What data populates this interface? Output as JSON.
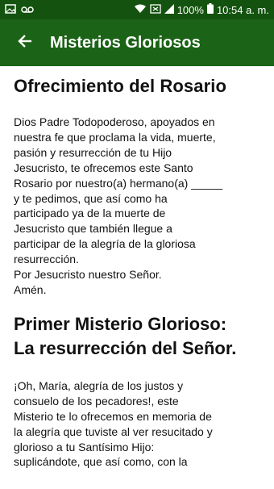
{
  "status_bar": {
    "battery_percent": "100%",
    "time": "10:54 a. m.",
    "icons": [
      "image-icon",
      "voicemail-icon",
      "wifi-icon",
      "cast-icon",
      "signal-icon",
      "battery-icon"
    ]
  },
  "app_bar": {
    "title": "Misterios Gloriosos",
    "back_icon": "arrow-back-icon"
  },
  "colors": {
    "status_bar": "#14530f",
    "app_bar": "#1b6316",
    "text": "#111111"
  },
  "sections": [
    {
      "heading": "Ofrecimiento del Rosario",
      "body": "Dios Padre Todopoderoso, apoyados en\nnuestra fe que proclama la vida, muerte,\npasión y resurrección de tu Hijo\nJesucristo, te ofrecemos este Santo\nRosario por nuestro(a) hermano(a) _____\ny te pedimos, que así como ha\nparticipado ya de la muerte de\nJesucristo que también llegue a\nparticipar de la alegría de la gloriosa\nresurrección.\nPor Jesucristo nuestro Señor.\nAmén."
    },
    {
      "heading": "Primer Misterio Glorioso:\nLa resurrección del Señor.",
      "body": "¡Oh, María, alegría de los justos y\nconsuelo de los pecadores!, este\nMisterio te lo ofrecemos en memoria de\nla alegría que tuviste al ver resucitado y\nglorioso a tu Santísimo Hijo:\nsuplicándote, que así como, con la"
    }
  ]
}
